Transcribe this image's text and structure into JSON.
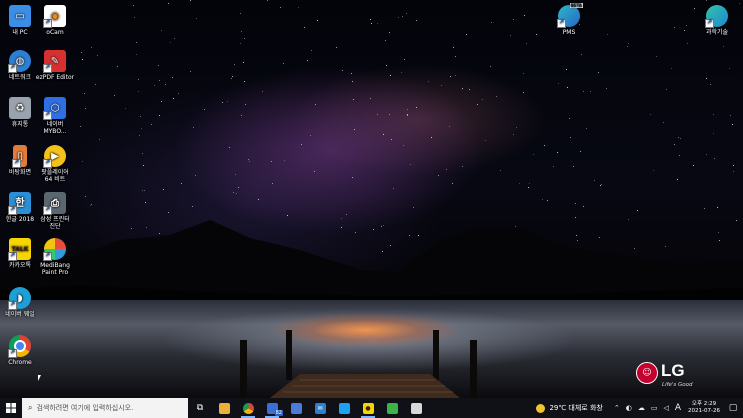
{
  "desktop_icons": [
    {
      "label": "내 PC",
      "icon": "this-pc-icon",
      "color": "#3a8ee6"
    },
    {
      "label": "oCam",
      "icon": "ocam-icon",
      "color": "#f08b1d"
    },
    {
      "label": "네트워크",
      "icon": "network-icon",
      "color": "#2d7fd3"
    },
    {
      "label": "ezPDF Editor",
      "icon": "ezpdf-icon",
      "color": "#d63031"
    },
    {
      "label": "휴지통",
      "icon": "recycle-bin-icon",
      "color": "#9aa3ad"
    },
    {
      "label": "네이버\nMYBO...",
      "icon": "naver-mybox-icon",
      "color": "#2f6fe4"
    },
    {
      "label": "바탕화면",
      "icon": "wallpaper-icon",
      "color": "#e07b39"
    },
    {
      "label": "팟플레이어\n64 비트",
      "icon": "potplayer-icon",
      "color": "#f4c21a"
    },
    {
      "label": "한글 2018",
      "icon": "hangul-icon",
      "color": "#2c8fd6"
    },
    {
      "label": "삼성 프린터\n진단",
      "icon": "samsung-printer-icon",
      "color": "#5a6670"
    },
    {
      "label": "카카오톡",
      "icon": "kakaotalk-icon",
      "color": "#f7d600"
    },
    {
      "label": "MediBang\nPaint Pro",
      "icon": "medibang-icon",
      "color": "#e74c3c"
    },
    {
      "label": "네이버 웨일",
      "icon": "naver-whale-icon",
      "color": "#1e9fd6"
    },
    {
      "label": "Chrome",
      "icon": "chrome-icon",
      "color": "#db4437"
    },
    {
      "label": "PMS",
      "icon": "edge-beta-icon",
      "color": "#2fb7c9"
    },
    {
      "label": "과학기술",
      "icon": "edge-icon",
      "color": "#1b8ad4"
    }
  ],
  "wallpaper_brand": {
    "logo": "LG",
    "tagline": "Life's Good",
    "color": "#c4002f"
  },
  "taskbar": {
    "search_placeholder": "검색하려면 여기에 입력하십시오.",
    "apps": [
      {
        "name": "task-view",
        "color": "#2d2f36",
        "glyph": "▤"
      },
      {
        "name": "file-explorer",
        "color": "#e8b23a",
        "glyph": ""
      },
      {
        "name": "chrome",
        "color": "#db4437",
        "glyph": ""
      },
      {
        "name": "calendar",
        "color": "#3a6fd6",
        "glyph": "",
        "badge": "82"
      },
      {
        "name": "store",
        "color": "#4a7bd8",
        "glyph": ""
      },
      {
        "name": "mail",
        "color": "#2f7fcf",
        "glyph": ""
      },
      {
        "name": "twitter-bird",
        "color": "#1da1f2",
        "glyph": ""
      },
      {
        "name": "kakaotalk",
        "color": "#f7d600",
        "glyph": ""
      },
      {
        "name": "green-app",
        "color": "#3bb34a",
        "glyph": ""
      },
      {
        "name": "hwp",
        "color": "#d9d9d9",
        "glyph": ""
      }
    ],
    "weather": "29℃  대체로 화창",
    "input_mode": "A",
    "clock_period_time": "오후 2:29",
    "clock_date": "2021-07-26"
  }
}
